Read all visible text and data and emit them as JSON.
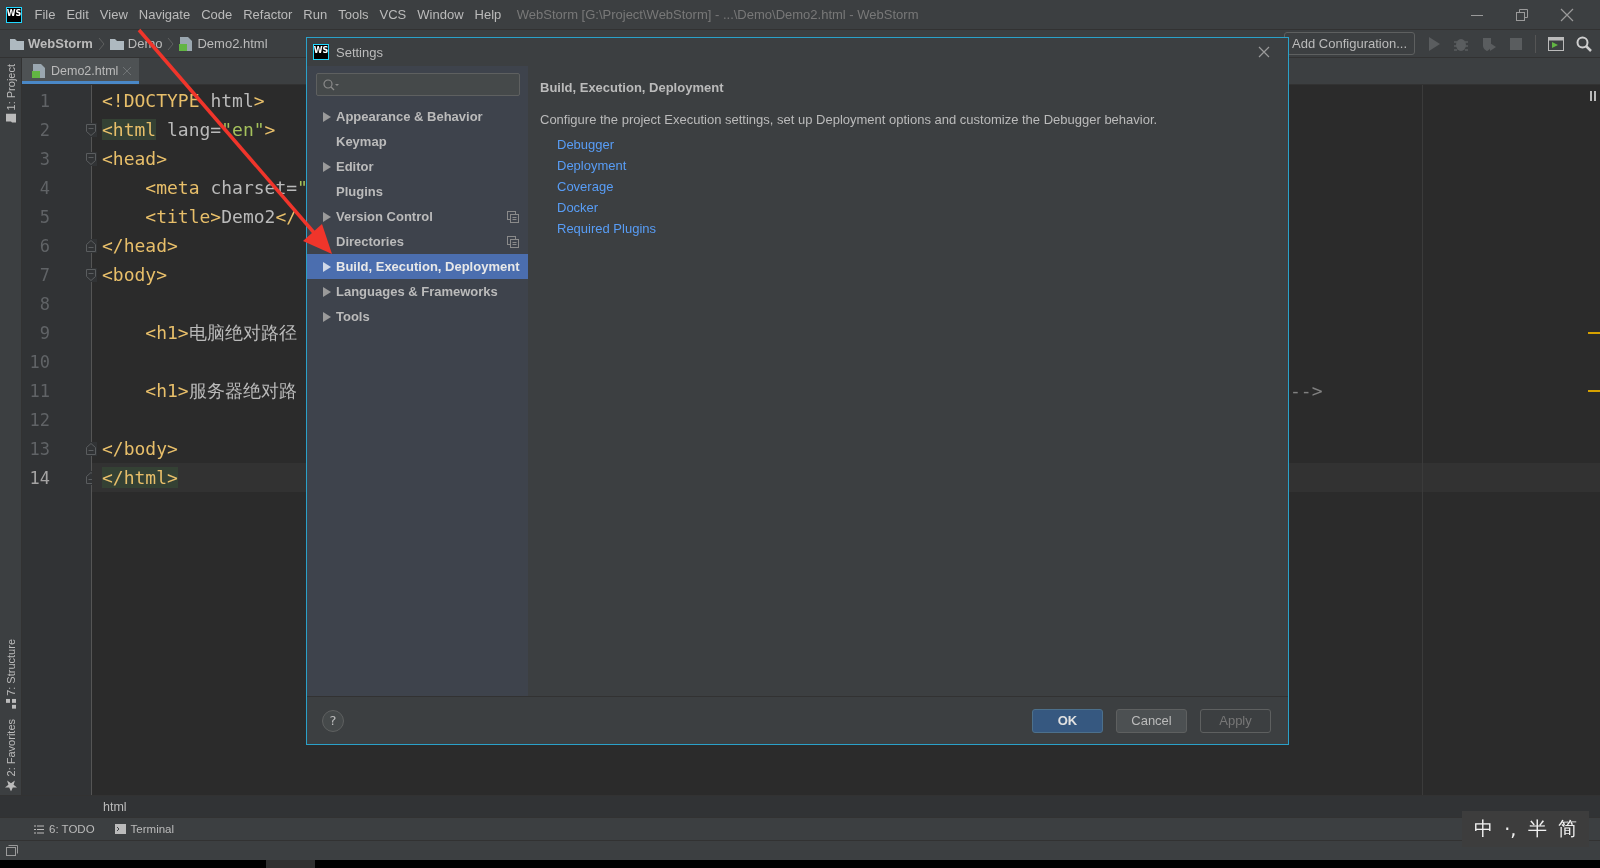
{
  "menu_bar": {
    "logo": "WS",
    "items": [
      "File",
      "Edit",
      "View",
      "Navigate",
      "Code",
      "Refactor",
      "Run",
      "Tools",
      "VCS",
      "Window",
      "Help"
    ],
    "title": "WebStorm [G:\\Project\\WebStorm] - ...\\Demo\\Demo2.html - WebStorm"
  },
  "nav_bar": {
    "breadcrumbs": [
      {
        "label": "WebStorm",
        "kind": "project"
      },
      {
        "label": "Demo",
        "kind": "folder"
      },
      {
        "label": "Demo2.html",
        "kind": "file"
      }
    ],
    "run_config": "Add Configuration..."
  },
  "tool_strip": {
    "top": [
      "1: Project"
    ],
    "bottom": [
      "7: Structure",
      "2: Favorites"
    ]
  },
  "editor": {
    "tabs": [
      {
        "label": "Demo2.html",
        "selected": true
      }
    ],
    "lines": [
      {
        "number": "1",
        "kind": "plain",
        "current": false,
        "tokens": [
          {
            "kind": "tag",
            "text": "<!DOCTYPE"
          },
          {
            "kind": "text",
            "text": " html"
          },
          {
            "kind": "tag",
            "text": ">"
          }
        ]
      },
      {
        "number": "2",
        "kind": "foldstart",
        "current": false,
        "tokens": [
          {
            "kind": "tag",
            "text": "<html",
            "match": true
          },
          {
            "kind": "text",
            "text": " lang="
          },
          {
            "kind": "string",
            "text": "\"en\""
          },
          {
            "kind": "tag",
            "text": ">"
          }
        ]
      },
      {
        "number": "3",
        "kind": "foldstart",
        "current": false,
        "tokens": [
          {
            "kind": "tag",
            "text": "<head>"
          }
        ]
      },
      {
        "number": "4",
        "kind": "plain",
        "current": false,
        "tokens": [
          {
            "kind": "tag",
            "text": "    <meta"
          },
          {
            "kind": "text",
            "text": " charset="
          },
          {
            "kind": "string",
            "text": "\""
          }
        ]
      },
      {
        "number": "5",
        "kind": "plain",
        "current": false,
        "tokens": [
          {
            "kind": "tag",
            "text": "    <title>"
          },
          {
            "kind": "text",
            "text": "Demo2"
          },
          {
            "kind": "tag",
            "text": "</"
          }
        ]
      },
      {
        "number": "6",
        "kind": "foldend",
        "current": false,
        "tokens": [
          {
            "kind": "tag",
            "text": "</head>"
          }
        ]
      },
      {
        "number": "7",
        "kind": "foldstart",
        "current": false,
        "tokens": [
          {
            "kind": "tag",
            "text": "<body>"
          }
        ]
      },
      {
        "number": "8",
        "kind": "plain",
        "current": false
      },
      {
        "number": "9",
        "kind": "plain",
        "current": false,
        "tokens": [
          {
            "kind": "tag",
            "text": "    <h1>"
          },
          {
            "kind": "text",
            "text": "电脑绝对路径"
          }
        ]
      },
      {
        "number": "10",
        "kind": "plain",
        "current": false
      },
      {
        "number": "11",
        "kind": "plain",
        "current": false,
        "tail": "-->",
        "tokens": [
          {
            "kind": "tag",
            "text": "    <h1>"
          },
          {
            "kind": "text",
            "text": "服务器绝对路"
          }
        ]
      },
      {
        "number": "12",
        "kind": "plain",
        "current": false
      },
      {
        "number": "13",
        "kind": "foldend",
        "current": false,
        "tokens": [
          {
            "kind": "tag",
            "text": "</body>"
          }
        ]
      },
      {
        "number": "14",
        "kind": "foldend",
        "current": true,
        "tokens": [
          {
            "kind": "tag",
            "text": "</html>",
            "match": true
          }
        ]
      }
    ]
  },
  "settings_dialog": {
    "logo": "WS",
    "title": "Settings",
    "nav": [
      {
        "label": "Appearance & Behavior",
        "kind": "group",
        "selected": false,
        "project_scoped": false
      },
      {
        "label": "Keymap",
        "kind": "page",
        "selected": false,
        "project_scoped": false
      },
      {
        "label": "Editor",
        "kind": "group",
        "selected": false,
        "project_scoped": false
      },
      {
        "label": "Plugins",
        "kind": "page",
        "selected": false,
        "project_scoped": false
      },
      {
        "label": "Version Control",
        "kind": "group",
        "selected": false,
        "project_scoped": true
      },
      {
        "label": "Directories",
        "kind": "page",
        "selected": false,
        "project_scoped": true
      },
      {
        "label": "Build, Execution, Deployment",
        "kind": "group",
        "selected": true,
        "project_scoped": false
      },
      {
        "label": "Languages & Frameworks",
        "kind": "group",
        "selected": false,
        "project_scoped": false
      },
      {
        "label": "Tools",
        "kind": "group",
        "selected": false,
        "project_scoped": false
      }
    ],
    "page": {
      "heading": "Build, Execution, Deployment",
      "description": "Configure the project Execution settings, set up Deployment options and customize the Debugger behavior.",
      "links": [
        "Debugger",
        "Deployment",
        "Coverage",
        "Docker",
        "Required Plugins"
      ]
    },
    "help": "?",
    "buttons": [
      {
        "label": "OK",
        "kind": "default",
        "disabled": false
      },
      {
        "label": "Cancel",
        "kind": "normal",
        "disabled": false
      },
      {
        "label": "Apply",
        "kind": "normal",
        "disabled": true
      }
    ]
  },
  "breadcrumb": "html",
  "tool_windows": [
    {
      "label": "6: TODO",
      "kind": "todo"
    },
    {
      "label": "Terminal",
      "kind": "terminal"
    }
  ],
  "ime": [
    "中",
    "·,",
    "半",
    "简"
  ]
}
